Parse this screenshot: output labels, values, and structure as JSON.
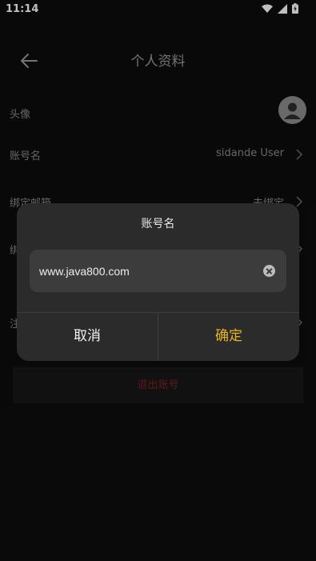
{
  "status": {
    "time": "11:14"
  },
  "header": {
    "title": "个人资料"
  },
  "rows": {
    "avatar": {
      "label": "头像"
    },
    "account": {
      "label": "账号名",
      "value": "sidande User"
    },
    "email": {
      "label": "绑定邮箱",
      "value": "去绑定"
    },
    "row4": {
      "label": "绑"
    },
    "row5": {
      "label": "注"
    }
  },
  "logout": {
    "label": "退出账号"
  },
  "dialog": {
    "title": "账号名",
    "input_value": "www.java800.com",
    "cancel": "取消",
    "confirm": "确定"
  },
  "colors": {
    "background": "#0d0d0d",
    "dialog": "#2b2b2b",
    "confirm": "#e8b71c",
    "logout_text": "#7b2422"
  }
}
